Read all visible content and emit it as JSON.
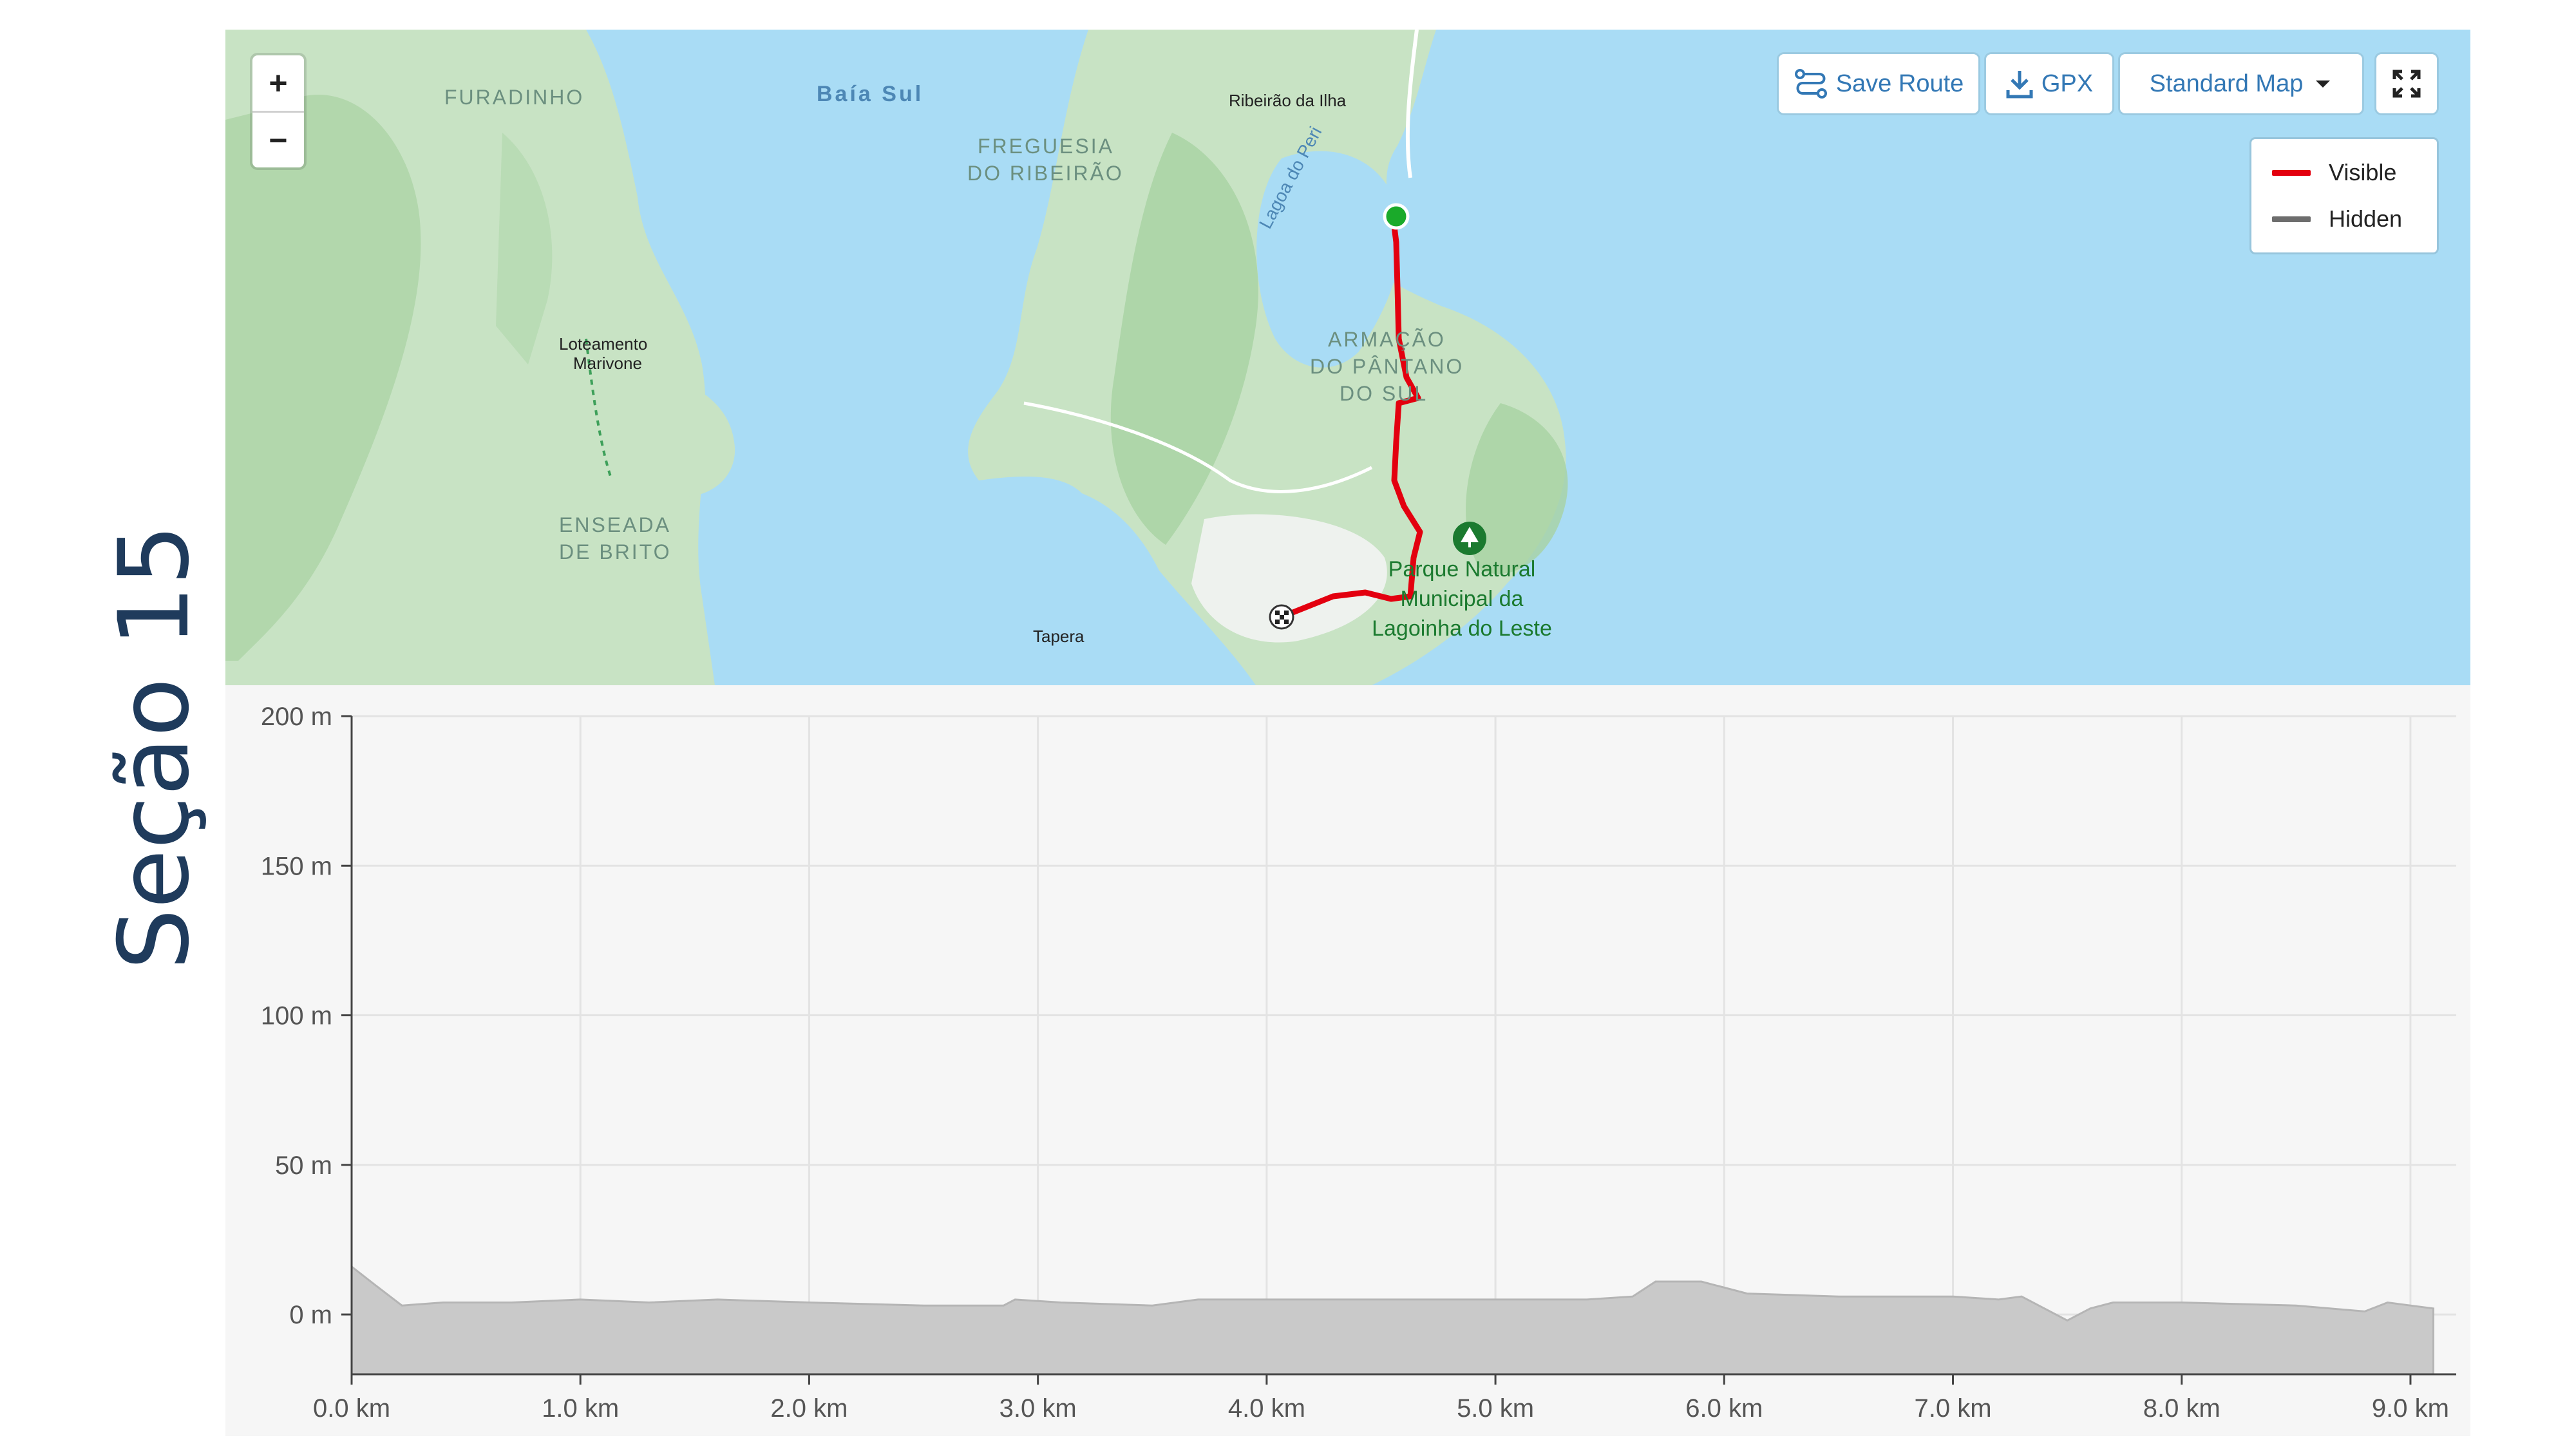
{
  "section_title": "Seção 15",
  "toolbar": {
    "zoom_in": "+",
    "zoom_out": "−",
    "save_route": "Save Route",
    "gpx": "GPX",
    "map_style": "Standard Map",
    "fullscreen_icon": "expand-icon"
  },
  "legend": {
    "visible": "Visible",
    "hidden": "Hidden",
    "visible_color": "#e3000f",
    "hidden_color": "#6d6d6d"
  },
  "map": {
    "labels": {
      "furadinho": "FURADINHO",
      "baia_sul": "Baía Sul",
      "freguesia_1": "FREGUESIA",
      "freguesia_2": "DO RIBEIRÃO",
      "ribeirao": "Ribeirão da Ilha",
      "lagoa": "Lagoa do Peri",
      "loteamento_1": "Loteamento",
      "loteamento_2": "Marivone",
      "armacao_1": "ARMAÇÃO",
      "armacao_2": "DO PÂNTANO",
      "armacao_3": "DO SUL",
      "enseada_1": "ENSEADA",
      "enseada_2": "DE BRITO",
      "tapera": "Tapera",
      "parque_1": "Parque Natural",
      "parque_2": "Municipal da",
      "parque_3": "Lagoinha do Leste"
    },
    "colors": {
      "water": "#a9dcf5",
      "land": "#c8e3c4",
      "route": "#e3000f",
      "start": "#1aaa2a"
    }
  },
  "chart_data": {
    "type": "area",
    "x_unit": "km",
    "y_unit": "m",
    "xlim": [
      0,
      9.2
    ],
    "ylim": [
      -20,
      200
    ],
    "x_ticks": [
      0,
      1,
      2,
      3,
      4,
      5,
      6,
      7,
      8,
      9
    ],
    "x_tick_labels": [
      "0.0 km",
      "1.0 km",
      "2.0 km",
      "3.0 km",
      "4.0 km",
      "5.0 km",
      "6.0 km",
      "7.0 km",
      "8.0 km",
      "9.0 km"
    ],
    "y_ticks": [
      0,
      50,
      100,
      150,
      200
    ],
    "y_tick_labels": [
      "0 m",
      "50 m",
      "100 m",
      "150 m",
      "200 m"
    ],
    "grid": true,
    "fill_color": "#c9c9c9",
    "x": [
      0,
      0.1,
      0.22,
      0.4,
      0.7,
      1.0,
      1.3,
      1.6,
      2.0,
      2.5,
      2.85,
      2.9,
      3.1,
      3.5,
      3.7,
      4.0,
      4.5,
      5.0,
      5.4,
      5.6,
      5.7,
      5.9,
      6.1,
      6.5,
      7.0,
      7.2,
      7.3,
      7.4,
      7.5,
      7.6,
      7.7,
      8.0,
      8.5,
      8.8,
      8.9,
      9.0,
      9.1
    ],
    "elevation": [
      16,
      10,
      3,
      4,
      4,
      5,
      4,
      5,
      4,
      3,
      3,
      5,
      4,
      3,
      5,
      5,
      5,
      5,
      5,
      6,
      11,
      11,
      7,
      6,
      6,
      5,
      6,
      2,
      -2,
      2,
      4,
      4,
      3,
      1,
      4,
      3,
      2
    ]
  }
}
